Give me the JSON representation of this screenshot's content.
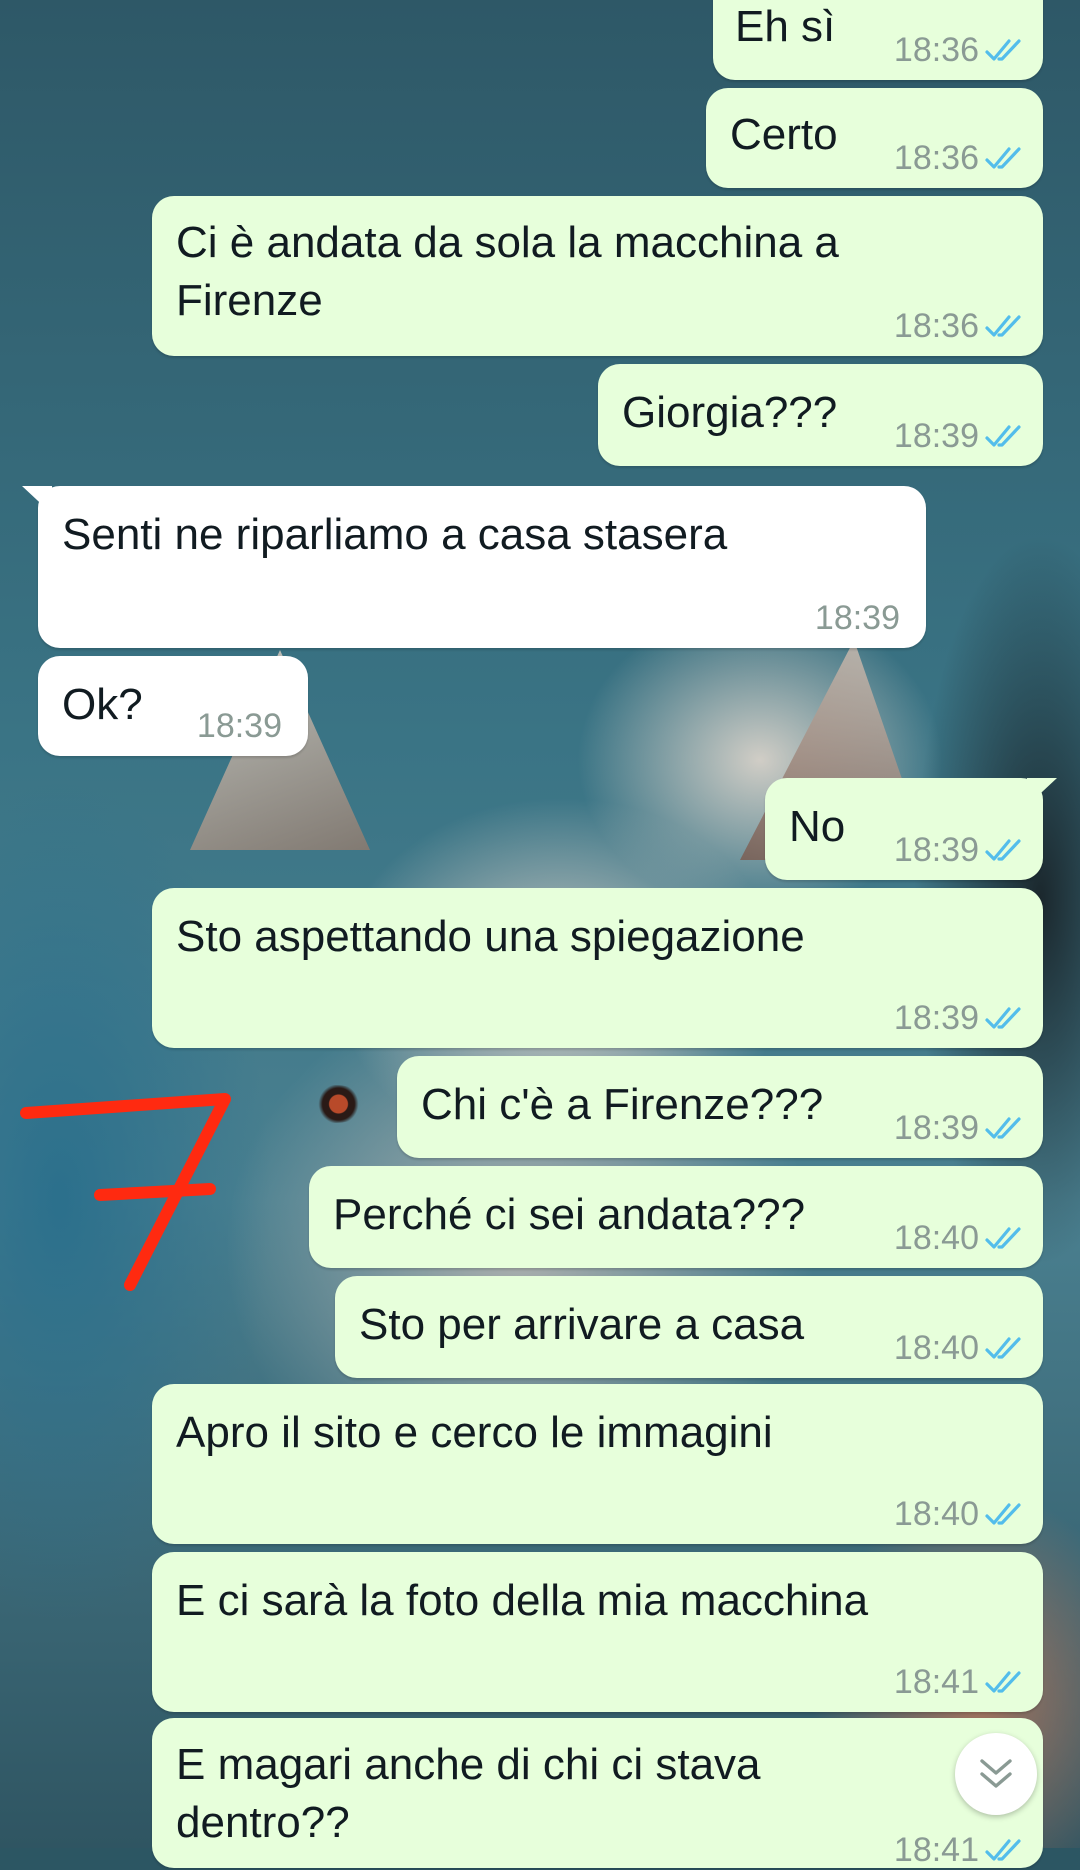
{
  "messages": [
    {
      "text": "Eh sì",
      "time": "18:36",
      "dir": "out"
    },
    {
      "text": "Certo",
      "time": "18:36",
      "dir": "out"
    },
    {
      "text": "Ci è andata da sola la macchina a\nFirenze",
      "time": "18:36",
      "dir": "out"
    },
    {
      "text": "Giorgia???",
      "time": "18:39",
      "dir": "out"
    },
    {
      "text": "Senti ne riparliamo a casa stasera",
      "time": "18:39",
      "dir": "in"
    },
    {
      "text": "Ok?",
      "time": "18:39",
      "dir": "in"
    },
    {
      "text": "No",
      "time": "18:39",
      "dir": "out"
    },
    {
      "text": "Sto aspettando una spiegazione",
      "time": "18:39",
      "dir": "out"
    },
    {
      "text": "Chi c'è a Firenze???",
      "time": "18:39",
      "dir": "out"
    },
    {
      "text": "Perché ci sei andata???",
      "time": "18:40",
      "dir": "out"
    },
    {
      "text": "Sto per arrivare a casa",
      "time": "18:40",
      "dir": "out"
    },
    {
      "text": "Apro il sito e cerco le immagini",
      "time": "18:40",
      "dir": "out"
    },
    {
      "text": "E ci sarà la foto della mia macchina",
      "time": "18:41",
      "dir": "out"
    },
    {
      "text": "E magari anche di chi ci stava\ndentro??",
      "time": "18:41",
      "dir": "out"
    }
  ],
  "colors": {
    "outgoing_bubble": "#e7ffdb",
    "incoming_bubble": "#ffffff",
    "read_ticks": "#53bdeb",
    "timestamp": "#8a9a94",
    "annotation": "#ff2a10"
  },
  "icons": {
    "read_receipt": "double-check-icon",
    "scroll_down": "double-chevron-down-icon"
  }
}
